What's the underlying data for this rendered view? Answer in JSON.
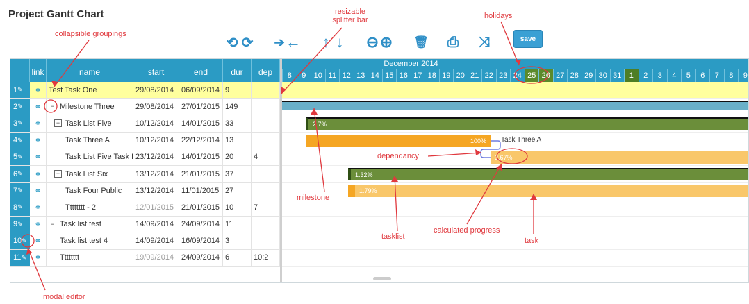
{
  "page_title": "Project Gantt Chart",
  "toolbar": {
    "undo": "⟲",
    "redo": "⟳",
    "outdent": "➔",
    "indent": "←",
    "move_up": "↑",
    "move_down": "↓",
    "zoom_out": "⊖",
    "zoom_in": "⊕",
    "delete": "🗑",
    "print": "⎙",
    "shuffle": "⤨",
    "save_label": "save"
  },
  "grid_headers": {
    "num": "",
    "link": "link",
    "name": "name",
    "start": "start",
    "end": "end",
    "dur": "dur",
    "dep": "dep"
  },
  "rows": [
    {
      "num": "1",
      "name": "Test Task One",
      "start": "29/08/2014",
      "end": "06/09/2014",
      "dur": "9",
      "dep": ""
    },
    {
      "num": "2",
      "name": "Milestone Three",
      "start": "29/08/2014",
      "end": "27/01/2015",
      "dur": "149",
      "dep": ""
    },
    {
      "num": "3",
      "name": "Task List Five",
      "start": "10/12/2014",
      "end": "14/01/2015",
      "dur": "33",
      "dep": ""
    },
    {
      "num": "4",
      "name": "Task Three A",
      "start": "10/12/2014",
      "end": "22/12/2014",
      "dur": "13",
      "dep": ""
    },
    {
      "num": "5",
      "name": "Task List Five Task B",
      "start": "23/12/2014",
      "end": "14/01/2015",
      "dur": "20",
      "dep": "4"
    },
    {
      "num": "6",
      "name": "Task List Six",
      "start": "13/12/2014",
      "end": "21/01/2015",
      "dur": "37",
      "dep": ""
    },
    {
      "num": "7",
      "name": "Task Four Public",
      "start": "13/12/2014",
      "end": "11/01/2015",
      "dur": "27",
      "dep": ""
    },
    {
      "num": "8",
      "name": "Tttttttt - 2",
      "start": "12/01/2015",
      "end": "21/01/2015",
      "dur": "10",
      "dep": "7"
    },
    {
      "num": "9",
      "name": "Task list test",
      "start": "14/09/2014",
      "end": "24/09/2014",
      "dur": "11",
      "dep": ""
    },
    {
      "num": "10",
      "name": "Task list test 4",
      "start": "14/09/2014",
      "end": "16/09/2014",
      "dur": "3",
      "dep": ""
    },
    {
      "num": "11",
      "name": "Tttttttt",
      "start": "19/09/2014",
      "end": "24/09/2014",
      "dur": "6",
      "dep": "10:2"
    }
  ],
  "timeline": {
    "month_label": "December 2014",
    "days": [
      "8",
      "9",
      "10",
      "11",
      "12",
      "13",
      "14",
      "15",
      "16",
      "17",
      "18",
      "19",
      "20",
      "21",
      "22",
      "23",
      "24",
      "25",
      "26",
      "27",
      "28",
      "29",
      "30",
      "31",
      "1",
      "2",
      "3",
      "4",
      "5",
      "6",
      "7",
      "8",
      "9"
    ],
    "holidays": [
      "25",
      "26"
    ]
  },
  "bars": {
    "task_list_five_progress": "2.7%",
    "task_three_a_progress": "100%",
    "task_three_a_label": "Task Three A",
    "task_b_progress": "3.67%",
    "task_list_six_progress": "1.32%",
    "task_four_progress": "1.79%"
  },
  "annotations": {
    "collapsible": "collapsible groupings",
    "splitter": "resizable splitter bar",
    "holidays": "holidays",
    "dependency": "dependancy",
    "milestone": "milestone",
    "tasklist": "tasklist",
    "calc_progress": "calculated progress",
    "task": "task",
    "modal": "modal editor"
  },
  "colors": {
    "header_blue": "#2b9bc4",
    "selected_row": "#ffff9e",
    "milestone_bar": "#6ab0c9",
    "tasklist_bar": "#6b8e3a",
    "task_bar": "#f5a623",
    "task_bar_light": "#f9c76a",
    "annotation_red": "#e0393e"
  }
}
